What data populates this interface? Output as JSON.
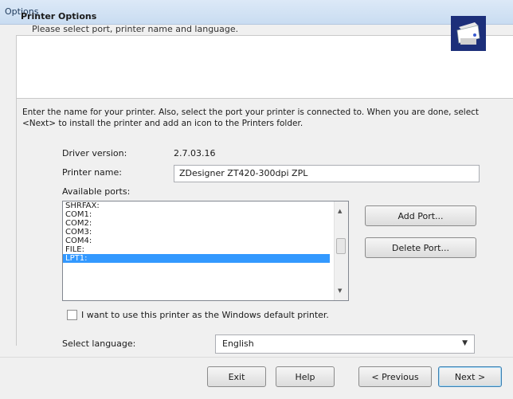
{
  "window": {
    "title": "Options"
  },
  "header": {
    "title": "Printer Options",
    "subtitle": "Please select port, printer name and language.",
    "icon": "printer-icon"
  },
  "description": "Enter the name for your printer. Also, select the port your printer is connected to. When you are done, select <Next> to install the printer and add an icon to the Printers folder.",
  "driver": {
    "label": "Driver version:",
    "value": "2.7.03.16"
  },
  "printer_name": {
    "label": "Printer name:",
    "value": "ZDesigner ZT420-300dpi ZPL"
  },
  "ports": {
    "label": "Available ports:",
    "items": [
      "SHRFAX:",
      "COM1:",
      "COM2:",
      "COM3:",
      "COM4:",
      "FILE:",
      "LPT1:"
    ],
    "selected": "LPT1:"
  },
  "buttons": {
    "add_port": "Add Port...",
    "delete_port": "Delete Port...",
    "exit": "Exit",
    "help": "Help",
    "previous": "< Previous",
    "next": "Next >"
  },
  "default_printer": {
    "label": "I want to use this printer as the Windows default printer.",
    "checked": false
  },
  "language": {
    "label": "Select language:",
    "value": "English"
  }
}
